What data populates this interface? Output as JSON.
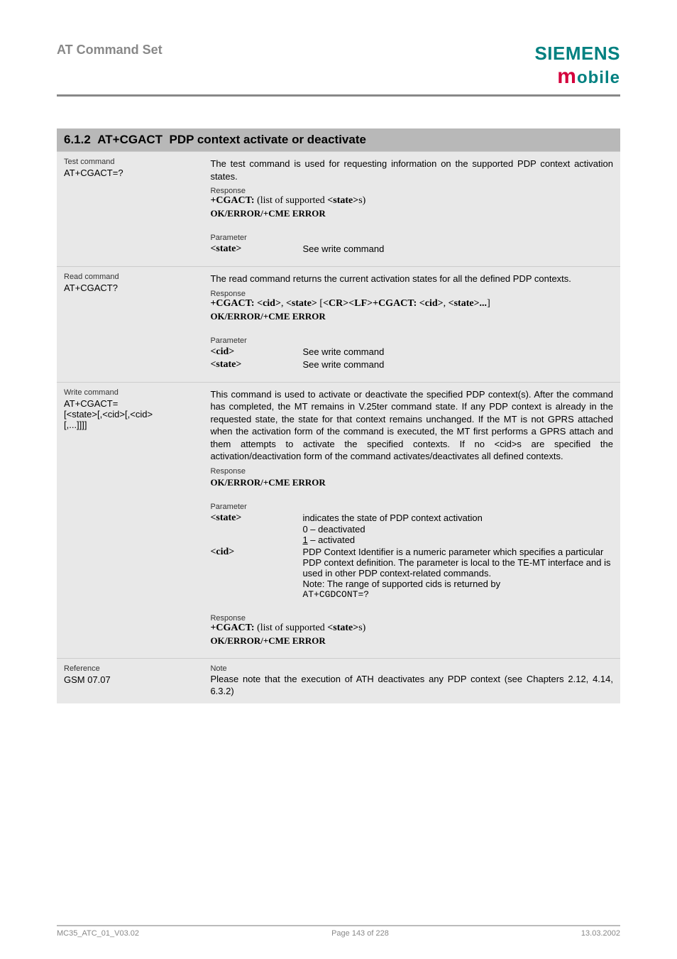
{
  "header": {
    "title": "AT Command Set",
    "logo_top": "SIEMENS",
    "logo_bottom_m": "m",
    "logo_bottom_rest": "obile"
  },
  "section": {
    "number": "6.1.2",
    "cmd": "AT+CGACT",
    "desc": "PDP context activate or deactivate"
  },
  "rows": {
    "test": {
      "label": "Test command",
      "cmd": "AT+CGACT=?",
      "body": "The test command is used for requesting information on the supported PDP context activation states.",
      "resp_label": "Response",
      "resp_line": "+CGACT: (list of supported <state>s)",
      "ok": "OK/ERROR/+CME ERROR",
      "param_label": "Parameter",
      "p_state": "<state>",
      "p_state_v": "See write command"
    },
    "read": {
      "label": "Read command",
      "cmd": "AT+CGACT?",
      "body": "The read command returns the current activation states for all the defined PDP contexts.",
      "resp_label": "Response",
      "resp_line": "+CGACT: <cid>, <state> [<CR><LF>+CGACT: <cid>, <state>...]",
      "ok": "OK/ERROR/+CME ERROR",
      "param_label": "Parameter",
      "p_cid": "<cid>",
      "p_cid_v": "See write command",
      "p_state": "<state>",
      "p_state_v": "See write command"
    },
    "write": {
      "label": "Write command",
      "cmd": "AT+CGACT=",
      "cmd2": "[<state>[,<cid>[,<cid>",
      "cmd3": "[,...]]]]",
      "body": "This command is used to activate or deactivate the specified PDP context(s). After the command has completed, the MT remains in V.25ter command state. If any PDP context is already in the requested state, the state for that context remains unchanged. If the MT is not GPRS attached when the activation form of the command is executed, the MT first performs a GPRS attach and them attempts to activate the specified contexts. If no <cid>s are specified the activation/deactivation form of the command activates/deactivates all defined contexts.",
      "resp_label": "Response",
      "ok": "OK/ERROR/+CME ERROR",
      "param_label": "Parameter",
      "p_state": "<state>",
      "p_state_desc": "indicates the state of PDP context activation",
      "p_state_0": "0 – deactivated",
      "p_state_1a": "1",
      "p_state_1b": " – activated",
      "p_cid": "<cid>",
      "p_cid_desc": "PDP Context Identifier is a numeric parameter which specifies a particular PDP context definition. The parameter is local to the TE-MT interface and is used in other PDP context-related commands.",
      "p_cid_note": "Note: The range of supported cids is returned by",
      "p_cid_cmd": "AT+CGDCONT=?",
      "resp_label2": "Response",
      "resp_line2": "+CGACT: (list of supported <state>s)",
      "ok2": "OK/ERROR/+CME ERROR"
    },
    "ref": {
      "label": "Reference",
      "val": "GSM 07.07",
      "nlabel": "Note",
      "nbody": "Please note that the execution of ATH deactivates any PDP context (see Chapters 2.12, 4.14, 6.3.2)"
    }
  },
  "footer": {
    "left": "MC35_ATC_01_V03.02",
    "center": "Page 143 of 228",
    "right": "13.03.2002"
  }
}
